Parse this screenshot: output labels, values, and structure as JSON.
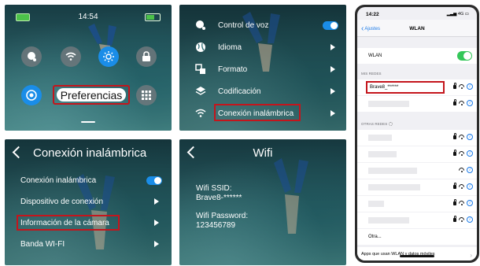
{
  "panel1": {
    "time": "14:54",
    "preferences_label": "Preferencias",
    "icons": [
      "voice-icon",
      "wifi-icon",
      "brightness-icon",
      "lock-icon",
      "camera-mode-icon",
      "grid-icon"
    ],
    "highlight_color": "#c4151c",
    "accent": "#1a8de8"
  },
  "panel2": {
    "items": [
      {
        "label": "Control de voz",
        "control": "toggle-on"
      },
      {
        "label": "Idioma",
        "control": "arrow"
      },
      {
        "label": "Formato",
        "control": "arrow"
      },
      {
        "label": "Codificación",
        "control": "arrow"
      },
      {
        "label": "Conexión inalámbrica",
        "control": "arrow",
        "highlighted": true
      }
    ]
  },
  "panel3": {
    "title": "Conexión inalámbrica",
    "items": [
      {
        "label": "Conexión inalámbrica",
        "control": "toggle-on"
      },
      {
        "label": "Dispositivo de conexión",
        "control": "arrow"
      },
      {
        "label": "Información de la cámara",
        "control": "arrow",
        "highlighted": true
      },
      {
        "label": "Banda WI-FI",
        "control": "arrow"
      }
    ]
  },
  "panel4": {
    "title": "Wifi",
    "ssid_label": "Wifi SSID:",
    "ssid_value": "Brave8-******",
    "password_label": "Wifi Password:",
    "password_value": "123456789"
  },
  "phone": {
    "status_time": "14:22",
    "status_right": "4G",
    "back_label": "Ajustes",
    "title": "WLAN",
    "wlan_label": "WLAN",
    "my_networks_header": "MIS REDES",
    "my_network_name": "Brave8_******",
    "other_networks_header": "OTRAS REDES",
    "other_label": "Otra...",
    "apps_label": "Apps que usan WLAN y datos móviles",
    "toggle_color": "#34c759",
    "link_color": "#1a7ae8"
  }
}
